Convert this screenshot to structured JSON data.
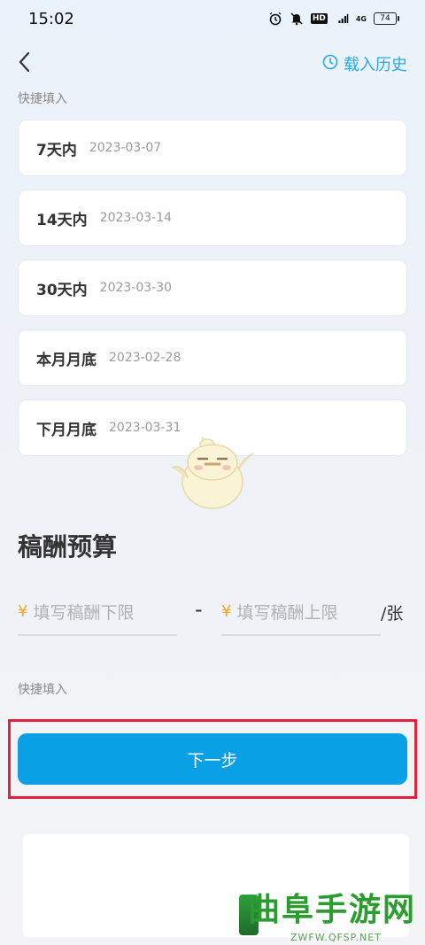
{
  "status_bar": {
    "time": "15:02",
    "hd_badge": "HD",
    "network": "4G",
    "battery": "74"
  },
  "header": {
    "history_label": "载入历史"
  },
  "quick_fill_label": "快捷填入",
  "quick_options": [
    {
      "name": "7天内",
      "date": "2023-03-07"
    },
    {
      "name": "14天内",
      "date": "2023-03-14"
    },
    {
      "name": "30天内",
      "date": "2023-03-30"
    },
    {
      "name": "本月月底",
      "date": "2023-02-28"
    },
    {
      "name": "下月月底",
      "date": "2023-03-31"
    }
  ],
  "budget": {
    "title": "稿酬预算",
    "currency": "¥",
    "min_placeholder": "填写稿酬下限",
    "max_placeholder": "填写稿酬上限",
    "separator": "-",
    "unit": "/张",
    "quick_fill_label": "快捷填入"
  },
  "next_button": "下一步",
  "watermark": {
    "text": "曲阜手游网",
    "url": "ZWFW.QFSP.NET"
  },
  "colors": {
    "accent": "#0aa0e5",
    "link": "#2aa8e0",
    "highlight_box": "#e0223a",
    "currency": "#f0a626"
  }
}
